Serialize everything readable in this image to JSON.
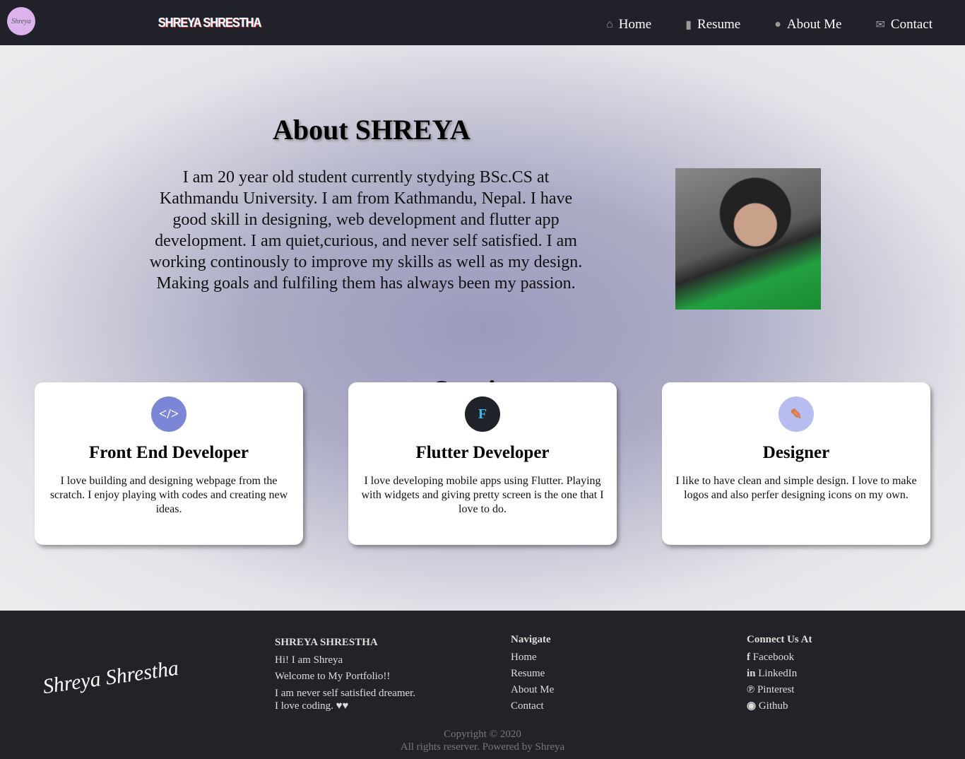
{
  "nav": {
    "logo_text": "Shreya",
    "brand": "SHREYA SHRESTHA",
    "items": [
      {
        "icon": "home-icon",
        "glyph": "⌂",
        "label": "Home"
      },
      {
        "icon": "file-icon",
        "glyph": "▮",
        "label": "Resume"
      },
      {
        "icon": "user-icon",
        "glyph": "●",
        "label": "About Me"
      },
      {
        "icon": "envelope-icon",
        "glyph": "✉",
        "label": "Contact"
      }
    ]
  },
  "about": {
    "title": "About SHREYA",
    "text": "I am 20 year old student currently stydying BSc.CS at Kathmandu University. I am from Kathmandu, Nepal. I have good skill in designing, web development and flutter app development. I am quiet,curious, and never self satisfied. I am working continously to improve my skills as well as my design. Making goals and fulfiling them has always been my passion."
  },
  "services": {
    "title": "Services",
    "cards": [
      {
        "glyph": "</>",
        "color": "#7b86d6",
        "title": "Front End Developer",
        "text": "I love building and designing webpage from the scratch. I enjoy playing with codes and creating new ideas."
      },
      {
        "glyph": "F",
        "color": "#1f2228",
        "title": "Flutter Developer",
        "text": "I love developing mobile apps using Flutter. Playing with widgets and giving pretty screen is the one that I love to do."
      },
      {
        "glyph": "✎",
        "color": "#b7bdf0",
        "title": "Designer",
        "text": "I like to have clean and simple design. I love to make logos and also perfer designing icons on my own."
      }
    ]
  },
  "footer": {
    "signature": "Shreya Shrestha",
    "about": {
      "title": "SHREYA SHRESTHA",
      "lines": [
        "Hi! I am Shreya",
        "Welcome to My Portfolio!!",
        "I am never self satisfied dreamer. I love coding. ♥♥"
      ]
    },
    "navigate": {
      "title": "Navigate",
      "links": [
        "Home",
        "Resume",
        "About Me",
        "Contact"
      ]
    },
    "connect": {
      "title": "Connect Us At",
      "links": [
        {
          "glyph": "f",
          "label": "Facebook"
        },
        {
          "glyph": "in",
          "label": "LinkedIn"
        },
        {
          "glyph": "℗",
          "label": "Pinterest"
        },
        {
          "glyph": "◉",
          "label": "Github"
        }
      ]
    },
    "copyright": "Copyright © 2020",
    "rights": "All rights reserver. Powered by Shreya"
  }
}
